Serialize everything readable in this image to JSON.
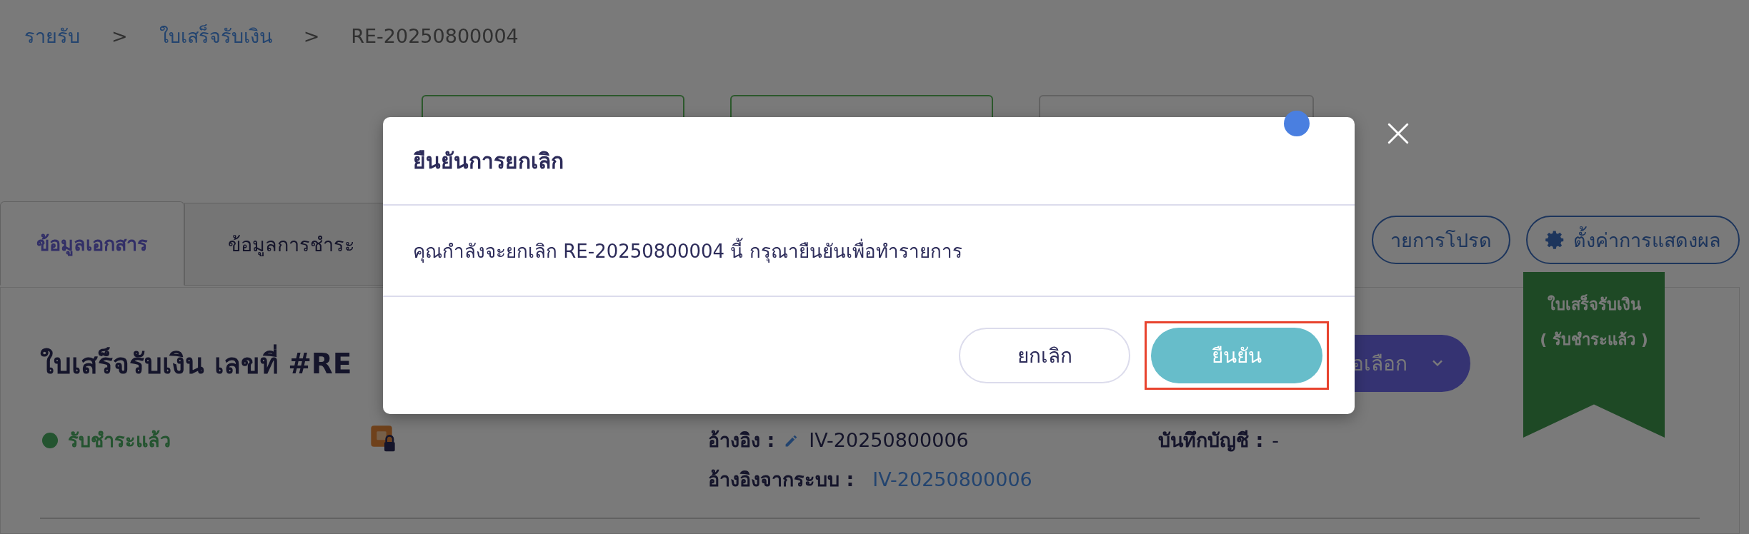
{
  "breadcrumb": [
    {
      "label": "รายรับ",
      "link": true
    },
    {
      "label": "ใบเสร็จรับเงิน",
      "link": true
    },
    {
      "label": "RE-20250800004",
      "link": false
    }
  ],
  "breadcrumb_separators": [
    ">",
    ">"
  ],
  "step_cards": [
    {
      "kind": "done"
    },
    {
      "kind": "done"
    },
    {
      "kind": "pending"
    }
  ],
  "tabs": [
    {
      "label": "ข้อมูลเอกสาร",
      "selected": true
    },
    {
      "label": "ข้อมูลการชำระ",
      "selected": false
    }
  ],
  "toolbar_buttons": [
    {
      "label": "ายการโปรด",
      "kind": "plain"
    },
    {
      "label": "ตั้งค่าการแสดงผล",
      "kind": "settings"
    }
  ],
  "document": {
    "title": "ใบเสร็จรับเงิน เลขที่ #RE",
    "status": {
      "label": "รับชำระแล้ว"
    },
    "options_button": "อเลือก",
    "ribbon": [
      "ใบเสร็จรับเงิน",
      "( รับชำระแล้ว )"
    ],
    "reference": {
      "label": "อ้างอิง :",
      "value": "IV-20250800006"
    },
    "system_reference": {
      "label": "อ้างอิงจากระบบ :",
      "value": "IV-20250800006"
    },
    "accounting": {
      "label": "บันทึกบัญชี :",
      "value": "-"
    }
  },
  "dialog": {
    "title": "ยืนยันการยกเลิก",
    "message": "คุณกำลังจะยกเลิก RE-20250800004 นี้ กรุณายืนยันเพื่อทำรายการ",
    "cancel": "ยกเลิก",
    "confirm": "ยืนยัน",
    "confirm_highlighted": true
  }
}
